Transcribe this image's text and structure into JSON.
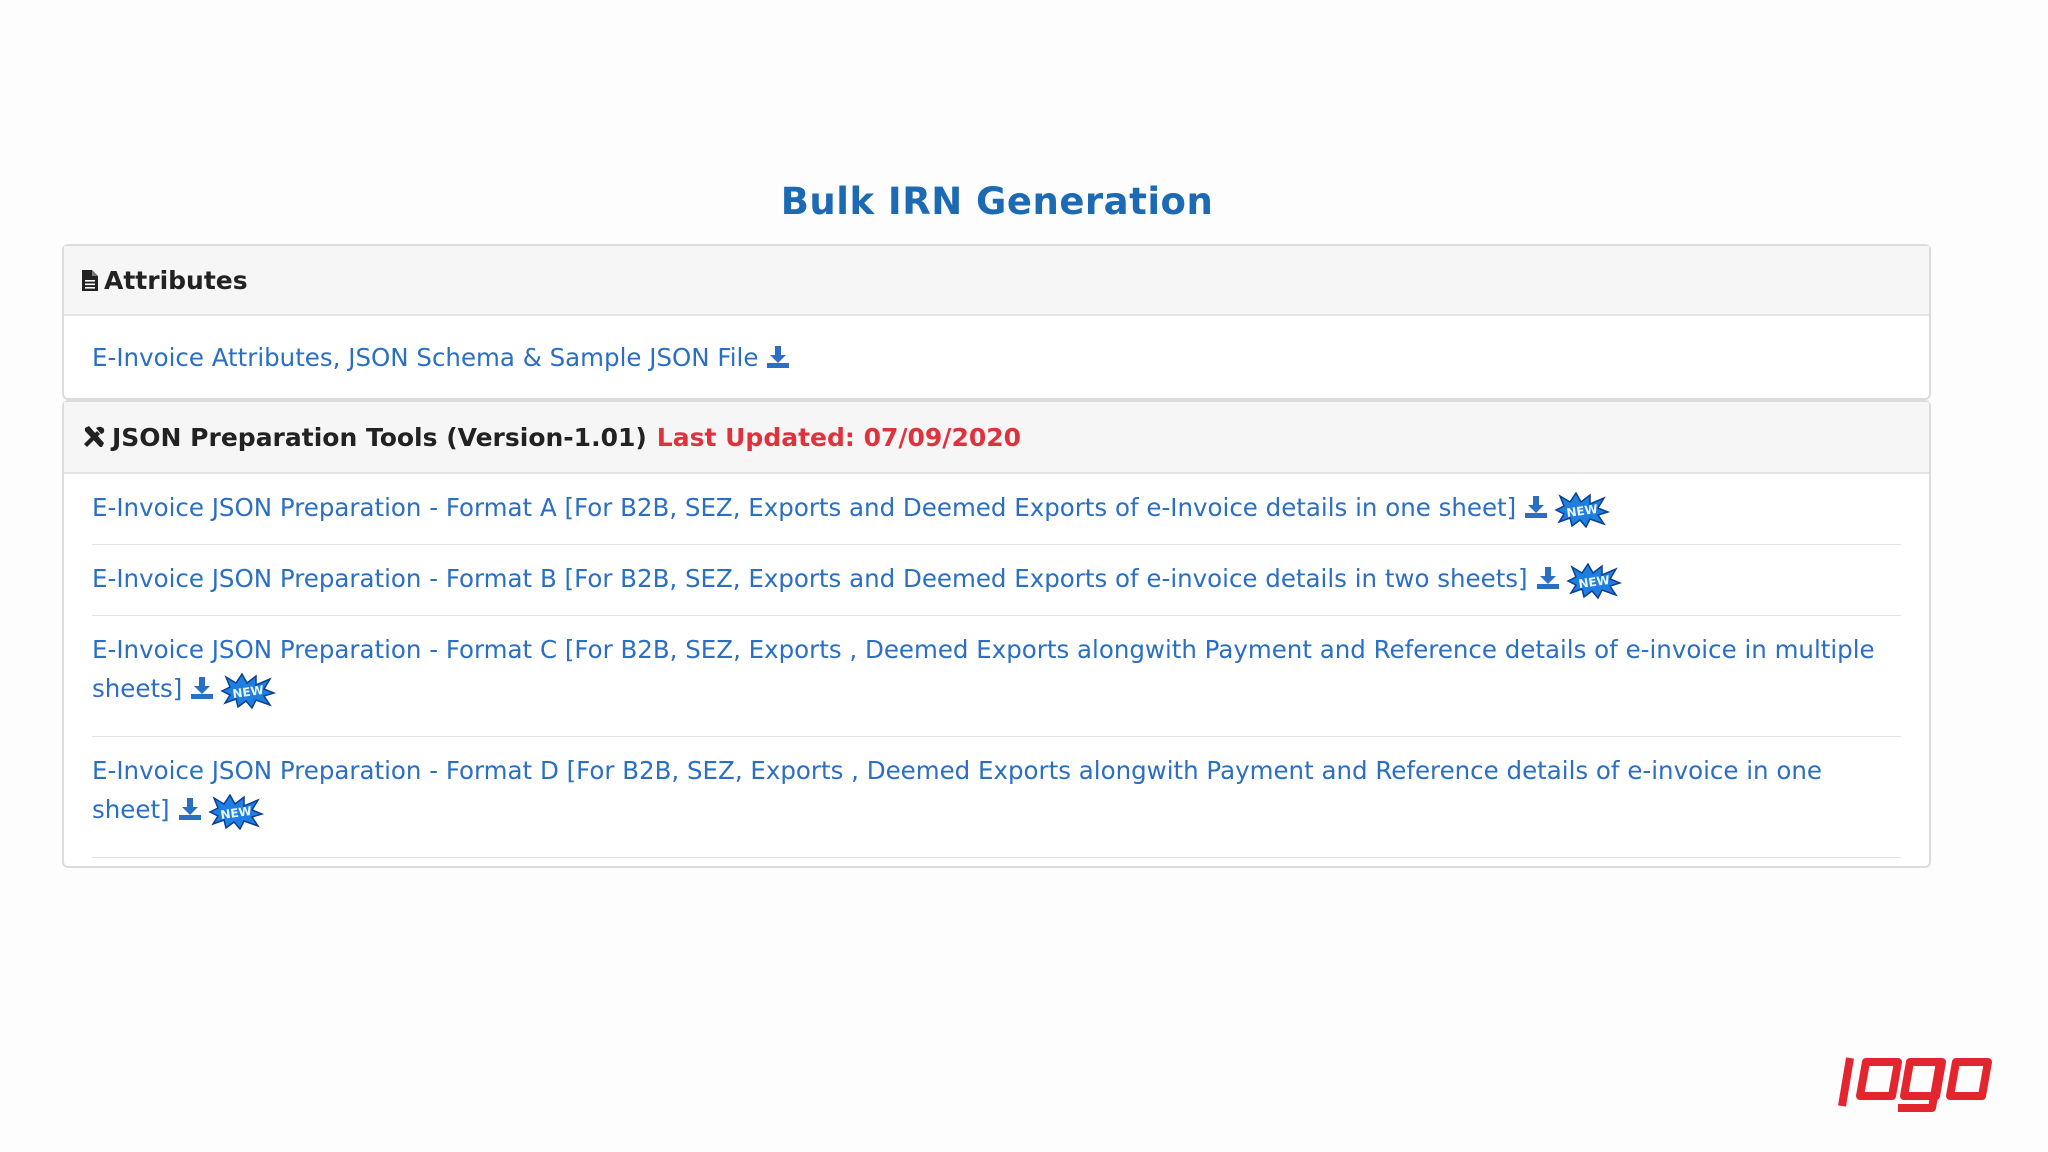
{
  "page": {
    "title": "Bulk IRN Generation"
  },
  "attributes": {
    "header": "Attributes",
    "link": "E-Invoice Attributes, JSON Schema & Sample JSON File"
  },
  "tools": {
    "header": "JSON Preparation Tools (Version-1.01)",
    "updated": "Last Updated: 07/09/2020",
    "items": [
      {
        "label": "E-Invoice JSON Preparation - Format A [For B2B, SEZ, Exports and Deemed Exports of e-Invoice details in one sheet]",
        "badge": "NEW"
      },
      {
        "label": "E-Invoice JSON Preparation - Format B [For B2B, SEZ, Exports and Deemed Exports of e-invoice details in two sheets]",
        "badge": "NEW"
      },
      {
        "label": "E-Invoice JSON Preparation - Format C [For B2B, SEZ, Exports , Deemed Exports alongwith Payment and Reference details of e-invoice in multiple sheets]",
        "badge": "NEW"
      },
      {
        "label": "E-Invoice JSON Preparation - Format D [For B2B, SEZ, Exports , Deemed Exports alongwith Payment and Reference details of e-invoice in one sheet]",
        "badge": "NEW"
      }
    ]
  },
  "watermark": {
    "text": "logo"
  },
  "colors": {
    "title": "#1b6ab3",
    "link": "#2a6fc4",
    "updated": "#e0323c",
    "badge": "#1e7fe0",
    "logo": "#e3262e"
  }
}
